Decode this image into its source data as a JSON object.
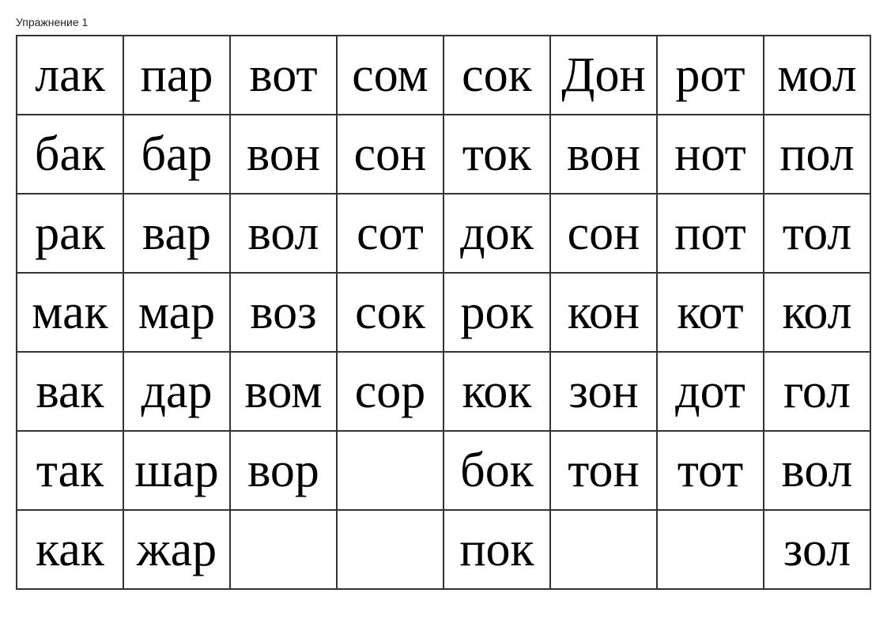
{
  "title": "Упражнение 1",
  "rows": [
    [
      "лак",
      "пар",
      "вот",
      "сом",
      "сок",
      "Дон",
      "рот",
      "мол"
    ],
    [
      "бак",
      "бар",
      "вон",
      "сон",
      "ток",
      "вон",
      "нот",
      "пол"
    ],
    [
      "рак",
      "вар",
      "вол",
      "сот",
      "док",
      "сон",
      "пот",
      "тол"
    ],
    [
      "мак",
      "мар",
      "воз",
      "сок",
      "рок",
      "кон",
      "кот",
      "кол"
    ],
    [
      "вак",
      "дар",
      "вом",
      "сор",
      "кок",
      "зон",
      "дот",
      "гол"
    ],
    [
      "так",
      "шар",
      "вор",
      "",
      "бок",
      "тон",
      "тот",
      "вол"
    ],
    [
      "как",
      "жар",
      "",
      "",
      "пок",
      "",
      "",
      "зол"
    ]
  ]
}
